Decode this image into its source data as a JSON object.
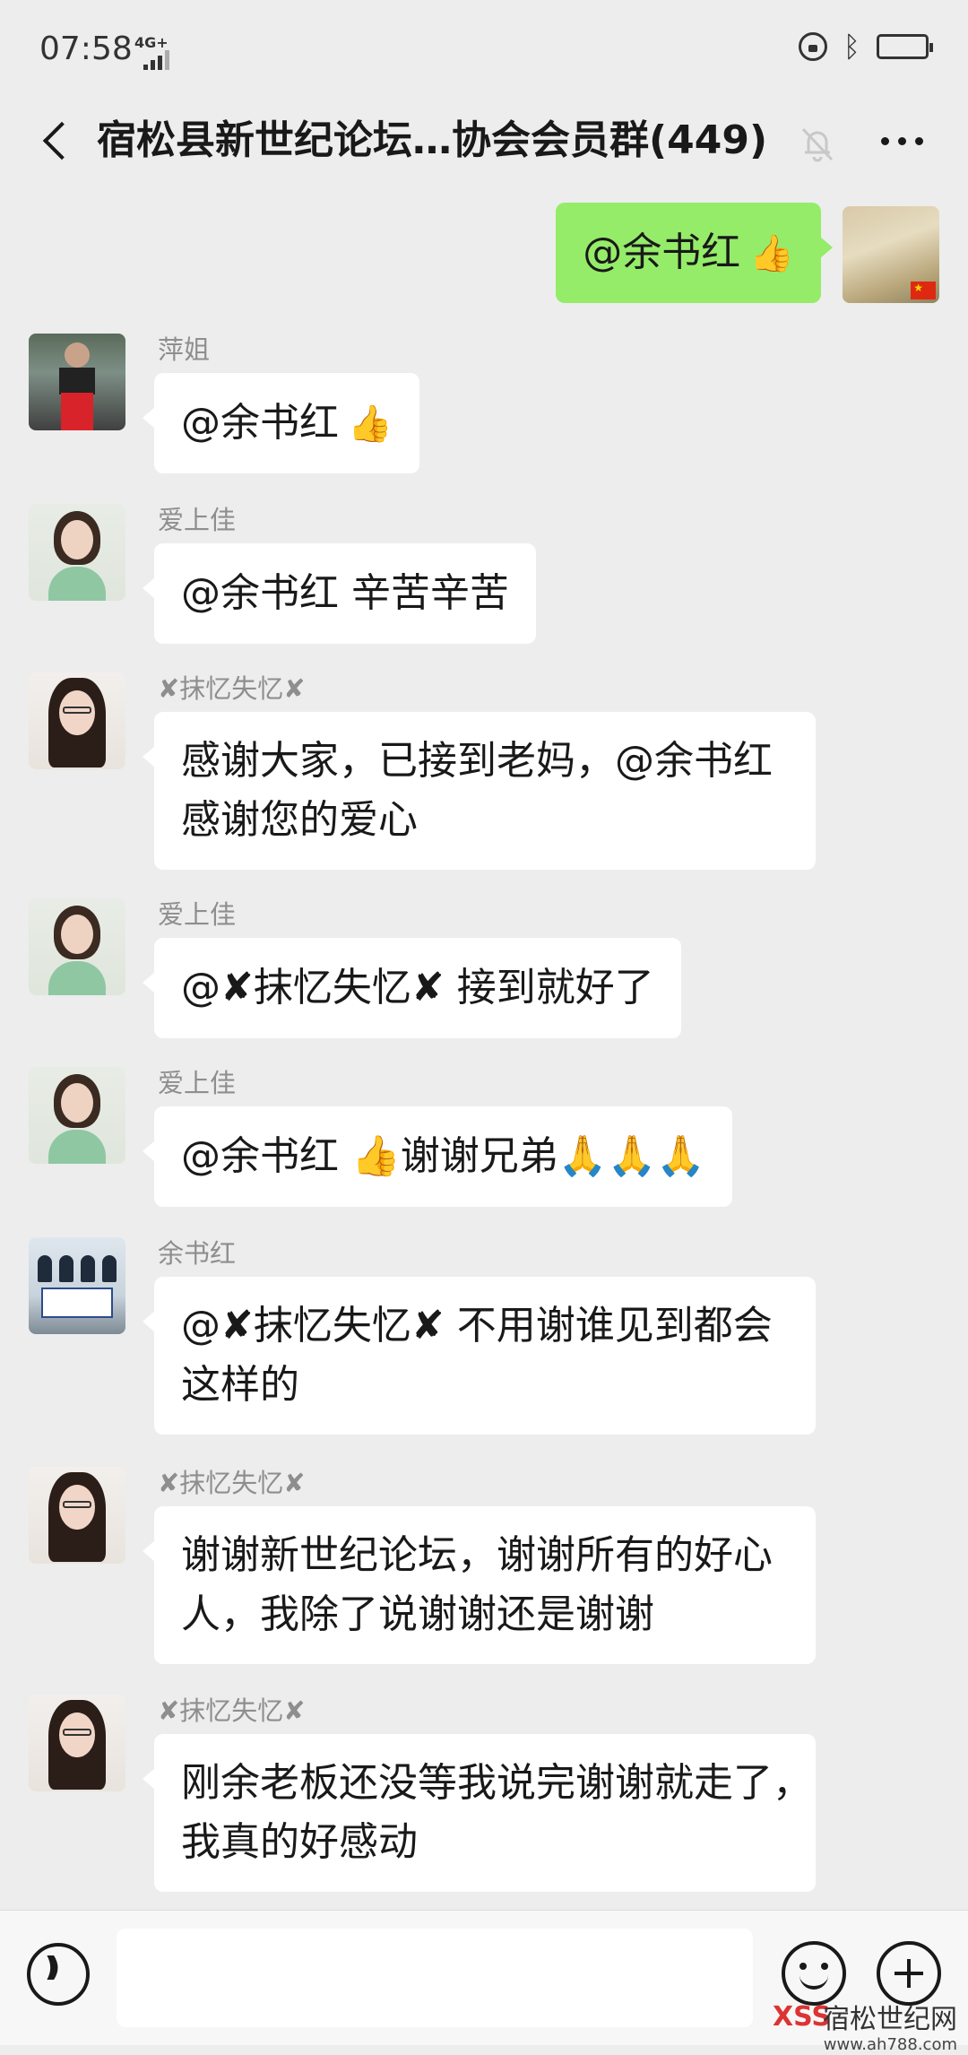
{
  "status": {
    "time": "07:58",
    "network": "4G+"
  },
  "header": {
    "title": "宿松县新世纪论坛…协会会员群(449)"
  },
  "messages": [
    {
      "side": "right",
      "lines": [
        "@余书红"
      ],
      "emoji": "👍"
    },
    {
      "side": "left",
      "sender": "萍姐",
      "lines": [
        "@余书红"
      ],
      "emoji": "👍"
    },
    {
      "side": "left",
      "sender": "爱上佳",
      "lines": [
        "@余书红  辛苦辛苦"
      ]
    },
    {
      "side": "left",
      "sender": "✘抹忆失忆✘",
      "lines": [
        "感谢大家，已接到老妈，@余书红",
        "感谢您的爱心"
      ]
    },
    {
      "side": "left",
      "sender": "爱上佳",
      "lines": [
        "@✘抹忆失忆✘ 接到就好了"
      ]
    },
    {
      "side": "left",
      "sender": "爱上佳",
      "lines": [
        "@余书红 👍谢谢兄弟🙏🙏🙏"
      ]
    },
    {
      "side": "left",
      "sender": "余书红",
      "lines": [
        "@✘抹忆失忆✘ 不用谢谁见到都会",
        "这样的"
      ]
    },
    {
      "side": "left",
      "sender": "✘抹忆失忆✘",
      "lines": [
        "谢谢新世纪论坛，谢谢所有的好心",
        "人，我除了说谢谢还是谢谢"
      ]
    },
    {
      "side": "left",
      "sender": "✘抹忆失忆✘",
      "lines": [
        "刚余老板还没等我说完谢谢就走了，",
        "我真的好感动"
      ]
    }
  ],
  "watermark": {
    "name": "宿松世纪网",
    "url": "www.ah788.com",
    "logo": "XSS"
  },
  "icons": {
    "back": "chevron-left-icon",
    "mute": "bell-off-icon",
    "more": "more-icon",
    "voice": "voice-icon",
    "emoji": "emoji-icon",
    "plus": "plus-icon"
  }
}
